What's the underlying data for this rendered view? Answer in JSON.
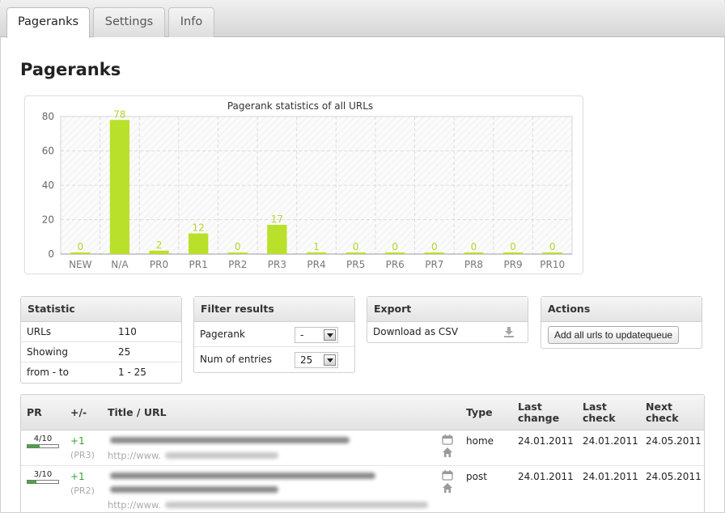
{
  "tabs": [
    {
      "label": "Pageranks",
      "active": true
    },
    {
      "label": "Settings",
      "active": false
    },
    {
      "label": "Info",
      "active": false
    }
  ],
  "page_title": "Pageranks",
  "chart_data": {
    "type": "bar",
    "title": "Pagerank statistics of all URLs",
    "categories": [
      "NEW",
      "N/A",
      "PR0",
      "PR1",
      "PR2",
      "PR3",
      "PR4",
      "PR5",
      "PR6",
      "PR7",
      "PR8",
      "PR9",
      "PR10"
    ],
    "values": [
      0,
      78,
      2,
      12,
      0,
      17,
      1,
      0,
      0,
      0,
      0,
      0,
      0
    ],
    "ylim": [
      0,
      80
    ],
    "yticks": [
      0,
      20,
      40,
      60,
      80
    ],
    "grid": true,
    "bar_color": "#b9e02a"
  },
  "statistic": {
    "title": "Statistic",
    "rows": [
      {
        "label": "URLs",
        "value": "110"
      },
      {
        "label": "Showing",
        "value": "25"
      },
      {
        "label": "from - to",
        "value": "1 - 25"
      }
    ]
  },
  "filter": {
    "title": "Filter results",
    "pagerank_label": "Pagerank",
    "pagerank_value": "-",
    "entries_label": "Num of entries",
    "entries_value": "25"
  },
  "export": {
    "title": "Export",
    "download_label": "Download as CSV",
    "icon": "download-icon"
  },
  "actions": {
    "title": "Actions",
    "button_label": "Add all urls to updatequeue"
  },
  "table": {
    "headers": {
      "pr": "PR",
      "change": "+/-",
      "title": "Title / URL",
      "type": "Type",
      "last_change": "Last change",
      "last_check": "Last check",
      "next_check": "Next check"
    },
    "rows": [
      {
        "pr": "4/10",
        "pr_fraction": 0.4,
        "change": "+1",
        "prev": "(PR3)",
        "url": "http://www.",
        "type": "home",
        "last_change": "24.01.2011",
        "last_check": "24.01.2011",
        "next_check": "24.05.2011"
      },
      {
        "pr": "3/10",
        "pr_fraction": 0.3,
        "change": "+1",
        "prev": "(PR2)",
        "url": "http://www.",
        "type": "post",
        "last_change": "24.01.2011",
        "last_check": "24.01.2011",
        "next_check": "24.05.2011"
      }
    ]
  }
}
